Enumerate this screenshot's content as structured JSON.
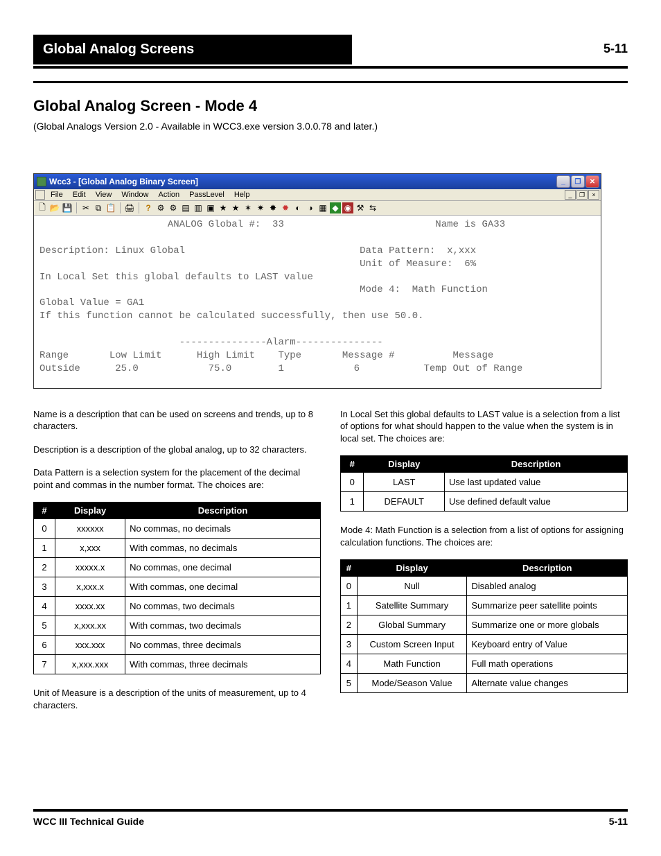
{
  "header": {
    "section_title": "Global Analog Screens",
    "page_top": "5-11",
    "page_title": "Global Analog Screen - Mode 4",
    "version_desc": "(Global Analogs Version 2.0 - Available in WCC3.exe version 3.0.0.78 and later.)"
  },
  "window": {
    "title": "Wcc3 - [Global Analog Binary Screen]",
    "menu": [
      "File",
      "Edit",
      "View",
      "Window",
      "Action",
      "PassLevel",
      "Help"
    ],
    "client_lines": [
      "                      ANALOG Global #:  33                          Name is GA33",
      "",
      "Description: Linux Global                              Data Pattern:  x,xxx",
      "                                                       Unit of Measure:  6%",
      "In Local Set this global defaults to LAST value",
      "                                                       Mode 4:  Math Function",
      "Global Value = GA1",
      "If this function cannot be calculated successfully, then use 50.0.",
      "",
      "                        ---------------Alarm---------------",
      "Range       Low Limit      High Limit    Type       Message #          Message",
      "Outside      25.0            75.0        1            6           Temp Out of Range"
    ]
  },
  "left": {
    "name_instr": "Name is a description that can be used on screens and trends, up to 8 characters.",
    "desc_instr": "Description is a description of the global analog, up to 32 characters.",
    "dp_intro": "Data Pattern is a selection system for the placement of the decimal point and commas in the number format. The choices are:",
    "um_intro": "Unit of Measure is a description of the units of measurement, up to 4 characters.",
    "lsd_intro": "In Local Set this global defaults to LAST value is a selection from a list of options for what should happen to the value when the system is in local set. The choices are:"
  },
  "right": {
    "mode_intro": "Mode 4: Math Function is a selection from a list of options for assigning calculation functions. The choices are:"
  },
  "table_headers": {
    "num": "#",
    "disp": "Display",
    "desc": "Description"
  },
  "tables": {
    "data_pattern": [
      {
        "n": "0",
        "disp": "xxxxxx",
        "desc": "No commas, no decimals"
      },
      {
        "n": "1",
        "disp": "x,xxx",
        "desc": "With commas, no decimals"
      },
      {
        "n": "2",
        "disp": "xxxxx.x",
        "desc": "No commas, one decimal"
      },
      {
        "n": "3",
        "disp": "x,xxx.x",
        "desc": "With commas, one decimal"
      },
      {
        "n": "4",
        "disp": "xxxx.xx",
        "desc": "No commas, two decimals"
      },
      {
        "n": "5",
        "disp": "x,xxx.xx",
        "desc": "With commas, two decimals"
      },
      {
        "n": "6",
        "disp": "xxx.xxx",
        "desc": "No commas, three decimals"
      },
      {
        "n": "7",
        "disp": "x,xxx.xxx",
        "desc": "With commas, three decimals"
      }
    ],
    "local_set": [
      {
        "n": "0",
        "disp": "LAST",
        "desc": "Use last updated value"
      },
      {
        "n": "1",
        "disp": "DEFAULT",
        "desc": "Use defined default value"
      }
    ],
    "mode_function": [
      {
        "n": "0",
        "disp": "Null",
        "desc": "Disabled analog"
      },
      {
        "n": "1",
        "disp": "Satellite Summary",
        "desc": "Summarize peer satellite points"
      },
      {
        "n": "2",
        "disp": "Global Summary",
        "desc": "Summarize one or more globals"
      },
      {
        "n": "3",
        "disp": "Custom Screen Input",
        "desc": "Keyboard entry of Value"
      },
      {
        "n": "4",
        "disp": "Math Function",
        "desc": "Full math operations"
      },
      {
        "n": "5",
        "disp": "Mode/Season Value",
        "desc": "Alternate value changes"
      }
    ]
  },
  "footer": {
    "left": "WCC III Technical Guide",
    "right": "5-11"
  }
}
